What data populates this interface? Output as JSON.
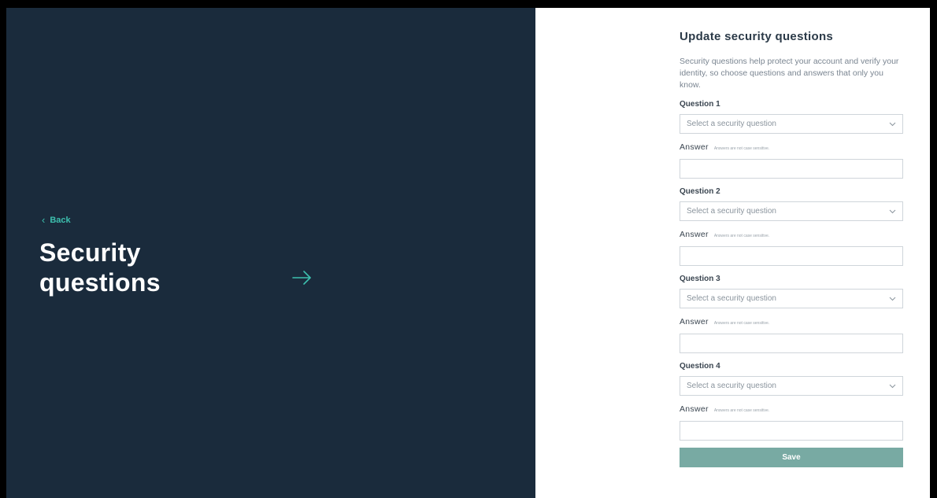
{
  "left": {
    "back_label": "Back",
    "title_line1": "Security",
    "title_line2": "questions"
  },
  "form": {
    "title": "Update security questions",
    "intro": "Security questions help protect your account and verify your identity, so choose questions and answers that only you know.",
    "questions": [
      {
        "label": "Question 1",
        "select_value": "Select a security question",
        "answer_label": "Answer",
        "answer_hint": "Answers are not case sensitive.",
        "answer_value": ""
      },
      {
        "label": "Question 2",
        "select_value": "Select a security question",
        "answer_label": "Answer",
        "answer_hint": "Answers are not case sensitive.",
        "answer_value": ""
      },
      {
        "label": "Question 3",
        "select_value": "Select a security question",
        "answer_label": "Answer",
        "answer_hint": "Answers are not case sensitive.",
        "answer_value": ""
      },
      {
        "label": "Question 4",
        "select_value": "Select a security question",
        "answer_label": "Answer",
        "answer_hint": "Answers are not case sensitive.",
        "answer_value": ""
      }
    ],
    "save_label": "Save"
  },
  "colors": {
    "left_panel_bg": "#1a2b3c",
    "accent": "#3dbfae",
    "save_button_bg": "#78aaa3"
  },
  "icons": {
    "back": "chevron-left-icon",
    "forward": "arrow-right-icon",
    "dropdown": "chevron-down-icon"
  }
}
